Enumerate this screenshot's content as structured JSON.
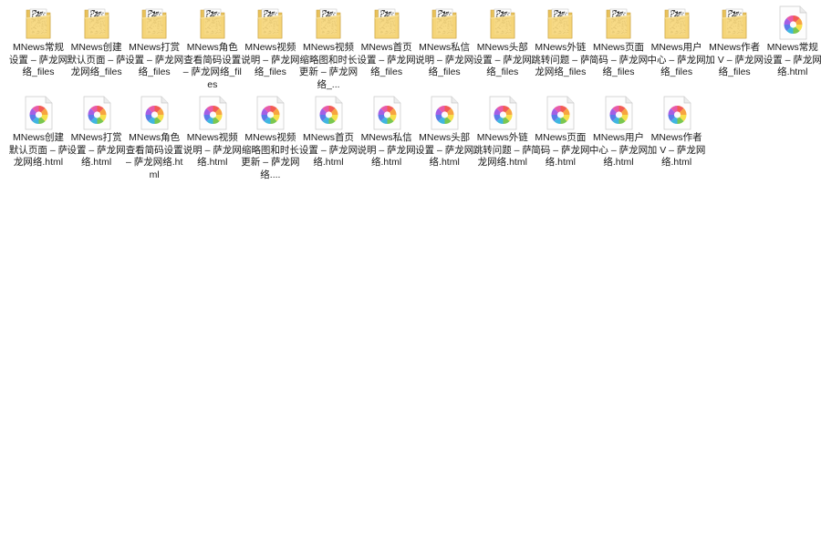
{
  "window": {
    "view": "large-icons"
  },
  "icon_types": {
    "folder": "folder-icon",
    "html": "html-file-icon"
  },
  "colors": {
    "folder_back": "#e8c15a",
    "folder_front": "#f7d77c",
    "folder_edge": "#c9a03c",
    "paper": "#ffffff",
    "label_text": "#1a1a1a",
    "background": "#ffffff"
  },
  "rows": [
    {
      "items": [
        {
          "label": "MNews常规设置 – 萨龙网络_files",
          "type": "folder"
        },
        {
          "label": "MNews创建默认页面 – 萨龙网络_files",
          "type": "folder"
        },
        {
          "label": "MNews打赏设置 – 萨龙网络_files",
          "type": "folder"
        },
        {
          "label": "MNews角色查看简码设置 – 萨龙网络_files",
          "type": "folder"
        },
        {
          "label": "MNews视频说明 – 萨龙网络_files",
          "type": "folder"
        },
        {
          "label": "MNews视频缩略图和时长更新 – 萨龙网络_...",
          "type": "folder"
        },
        {
          "label": "MNews首页设置 – 萨龙网络_files",
          "type": "folder"
        },
        {
          "label": "MNews私信说明 – 萨龙网络_files",
          "type": "folder"
        },
        {
          "label": "MNews头部设置 – 萨龙网络_files",
          "type": "folder"
        },
        {
          "label": "MNews外链跳转问题 – 萨龙网络_files",
          "type": "folder"
        },
        {
          "label": "MNews页面简码 – 萨龙网络_files",
          "type": "folder"
        },
        {
          "label": "MNews用户中心 – 萨龙网络_files",
          "type": "folder"
        },
        {
          "label": "MNews作者加 V – 萨龙网络_files",
          "type": "folder"
        },
        {
          "label": "MNews常规设置 – 萨龙网络.html",
          "type": "html"
        }
      ]
    },
    {
      "items": [
        {
          "label": "MNews创建默认页面 – 萨龙网络.html",
          "type": "html"
        },
        {
          "label": "MNews打赏设置 – 萨龙网络.html",
          "type": "html"
        },
        {
          "label": "MNews角色查看简码设置 – 萨龙网络.html",
          "type": "html"
        },
        {
          "label": "MNews视频说明 – 萨龙网络.html",
          "type": "html"
        },
        {
          "label": "MNews视频缩略图和时长更新 – 萨龙网络....",
          "type": "html"
        },
        {
          "label": "MNews首页设置 – 萨龙网络.html",
          "type": "html"
        },
        {
          "label": "MNews私信说明 – 萨龙网络.html",
          "type": "html"
        },
        {
          "label": "MNews头部设置 – 萨龙网络.html",
          "type": "html"
        },
        {
          "label": "MNews外链跳转问题 – 萨龙网络.html",
          "type": "html"
        },
        {
          "label": "MNews页面简码 – 萨龙网络.html",
          "type": "html"
        },
        {
          "label": "MNews用户中心 – 萨龙网络.html",
          "type": "html"
        },
        {
          "label": "MNews作者加 V – 萨龙网络.html",
          "type": "html"
        }
      ]
    }
  ]
}
